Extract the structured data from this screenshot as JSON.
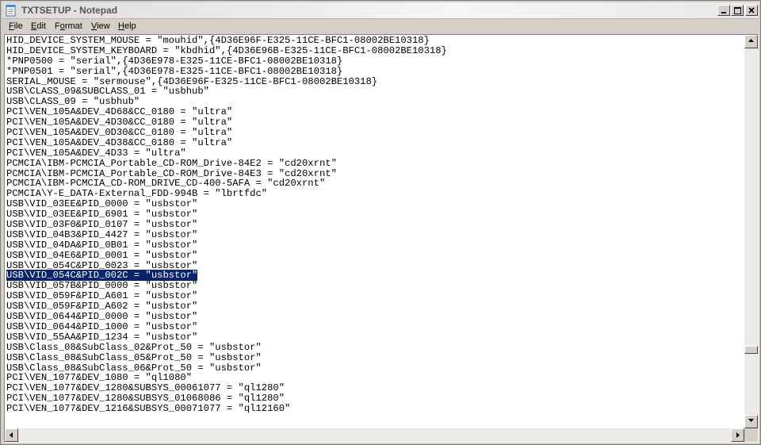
{
  "window": {
    "title": "TXTSETUP - Notepad"
  },
  "menu": [
    {
      "label": "File",
      "key": "F",
      "rest": "ile"
    },
    {
      "label": "Edit",
      "key": "E",
      "rest": "dit"
    },
    {
      "label": "Format",
      "key": "o",
      "pre": "F",
      "rest": "rmat"
    },
    {
      "label": "View",
      "key": "V",
      "rest": "iew"
    },
    {
      "label": "Help",
      "key": "H",
      "rest": "elp"
    }
  ],
  "content": {
    "selected_line_index": 27,
    "lines": [
      "HID_DEVICE_SYSTEM_MOUSE = \"mouhid\",{4D36E96F-E325-11CE-BFC1-08002BE10318}",
      "HID_DEVICE_SYSTEM_KEYBOARD = \"kbdhid\",{4D36E96B-E325-11CE-BFC1-08002BE10318}",
      "*PNP0500 = \"serial\",{4D36E978-E325-11CE-BFC1-08002BE10318}",
      "*PNP0501 = \"serial\",{4D36E978-E325-11CE-BFC1-08002BE10318}",
      "SERIAL_MOUSE = \"sermouse\",{4D36E96F-E325-11CE-BFC1-08002BE10318}",
      "USB\\CLASS_09&SUBCLASS_01 = \"usbhub\"",
      "USB\\CLASS_09 = \"usbhub\"",
      "PCI\\VEN_105A&DEV_4D68&CC_0180 = \"ultra\"",
      "PCI\\VEN_105A&DEV_4D30&CC_0180 = \"ultra\"",
      "PCI\\VEN_105A&DEV_0D30&CC_0180 = \"ultra\"",
      "PCI\\VEN_105A&DEV_4D38&CC_0180 = \"ultra\"",
      "PCI\\VEN_105A&DEV_4D33 = \"ultra\"",
      "PCMCIA\\IBM-PCMCIA_Portable_CD-ROM_Drive-84E2 = \"cd20xrnt\"",
      "PCMCIA\\IBM-PCMCIA_Portable_CD-ROM_Drive-84E3 = \"cd20xrnt\"",
      "PCMCIA\\IBM-PCMCIA_CD-ROM_DRIVE_CD-400-5AFA = \"cd20xrnt\"",
      "PCMCIA\\Y-E_DATA-External_FDD-994B = \"lbrtfdc\"",
      "USB\\VID_03EE&PID_0000 = \"usbstor\"",
      "USB\\VID_03EE&PID_6901 = \"usbstor\"",
      "USB\\VID_03F0&PID_0107 = \"usbstor\"",
      "USB\\VID_04B3&PID_4427 = \"usbstor\"",
      "USB\\VID_04DA&PID_0B01 = \"usbstor\"",
      "USB\\VID_04E6&PID_0001 = \"usbstor\"",
      "USB\\VID_054C&PID_0023 = \"usbstor\"",
      "USB\\VID_054C&PID_002C = \"usbstor\"",
      "USB\\VID_057B&PID_0000 = \"usbstor\"",
      "USB\\VID_059F&PID_A601 = \"usbstor\"",
      "USB\\VID_059F&PID_A602 = \"usbstor\"",
      "USB\\VID_0644&PID_0000 = \"usbstor\"",
      "USB\\VID_0644&PID_1000 = \"usbstor\"",
      "USB\\VID_55AA&PID_1234 = \"usbstor\"",
      "USB\\Class_08&SubClass_02&Prot_50 = \"usbstor\"",
      "USB\\Class_08&SubClass_05&Prot_50 = \"usbstor\"",
      "USB\\Class_08&SubClass_06&Prot_50 = \"usbstor\"",
      "PCI\\VEN_1077&DEV_1080 = \"ql1080\"",
      "PCI\\VEN_1077&DEV_1280&SUBSYS_00061077 = \"ql1280\"",
      "PCI\\VEN_1077&DEV_1280&SUBSYS_01068086 = \"ql1280\"",
      "PCI\\VEN_1077&DEV_1216&SUBSYS_00071077 = \"ql12160\""
    ]
  },
  "vertical_scroll_position": 0.83,
  "colors": {
    "selection_bg": "#0a246a",
    "selection_fg": "#ffffff",
    "chrome": "#d4d0c8"
  },
  "icons": {
    "app": "notepad-icon",
    "minimize": "minimize-icon",
    "maximize": "maximize-icon",
    "close": "close-icon"
  }
}
